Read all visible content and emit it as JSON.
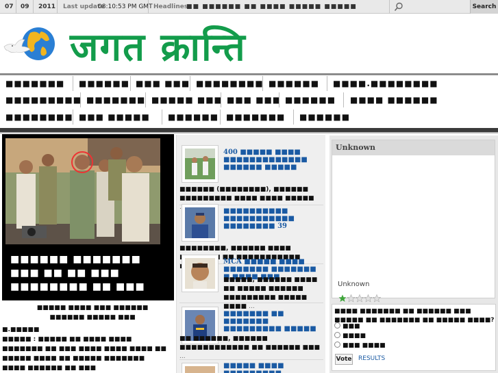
{
  "topbar": {
    "day": "07",
    "month": "09",
    "year": "2011",
    "last_update_label": "Last update",
    "last_update_time": "08:10:53 PM GMT",
    "headlines_label": "Headlines:",
    "headline_ticker": "■■ ■■■■■■ ■■ ■■■■ ■■■■■ ■■■■■",
    "search_placeholder": "",
    "search_button": "Search"
  },
  "site": {
    "title": "जगत क्रान्ति"
  },
  "nav": {
    "row1": [
      "■■■■■■■",
      "■■■■■■",
      "■■■ ■■■",
      "■■■■■■■■",
      "■■■■■■",
      "■■■■.■■■■■■■■"
    ],
    "row2": [
      "■■■■■■■■■",
      "■■■■■■■",
      "■■■■■ ■■■",
      "■■■ ■■■",
      "■■■■■■",
      "■■■■ ■■■■■■"
    ],
    "row3": [
      "■■■■■■■■",
      "■■■ ■■■■■",
      "■■■■■■",
      "■■■■■■■",
      "■■■■■■"
    ]
  },
  "lead": {
    "headline": "■■■■■■ ■■■■■■■ ■■■ ■■ ■■ ■■■ ■■■■■■■■ ■■ ■■■",
    "caption": "■■■■■ ■■■■ ■■■ ■■■■■■ ■■■■■■ ■■■■■ ■■■",
    "body_line1": "■.■■■■■",
    "body_line2": "■■■■■ : ■■■■■ ■■ ■■■■ ■■■■ ■■■■■■■ ■■ ■■■ ■■■■ ■■■■ ■■■■ ■■ ■■■■■ ■■■■ ■■ ■■■■■ ■■■■■■■ ■■■■ ■■■■■■ ■■ ■■■"
  },
  "stories": [
    {
      "title_num": "400",
      "title": "■■■■■ ■■■■ ■■■■■■■■■■■■■ ■■■■■■ ■■■■■",
      "text": "■■■■■■ (■■■■■■■■), ■■■■■■ ■■■■■■■■■ ■■■■ ■■■■ ■■■■■",
      "more": "..."
    },
    {
      "title_num": "39",
      "title": "■■■■■■■■■■ ■■■■■■■■■■■ ■■■■■■■■",
      "text": "■■■■■■■■, ■■■■■■ ■■■■ ■■■■■■■ ■■ ■■■■■■■■■■■ ■■■■■",
      "more": "..."
    },
    {
      "title_num": "MCA",
      "title": "■■■■■ ■■■■ ■■■■■■■ ■■■■■■■ ■ ■■■■ ■■■",
      "text": "■■■■■, ■■■■■■ ■■■■ ■■ ■■■■■ ■■■■■■ ■■■■■■■■■ ■■■■■ ■■■■",
      "more": "..."
    },
    {
      "title_num": "",
      "title": "■■■■■■■ ■■ ■■■■■■■ ■■■■■■■■■ ■■■■■",
      "text": "■■ ■■■■■■, ■■■■■■ ■■■■■■■■■■■■ ■■ ■■■■■■ ■■■",
      "more": "..."
    },
    {
      "title_num": "",
      "title": "■■■■■ ■■■■ ■■■■■■■■■",
      "text": "",
      "more": ""
    }
  ],
  "media": {
    "title": "Unknown",
    "caption": "Unknown",
    "rating": 1,
    "rating_max": 5
  },
  "poll": {
    "question": "■■■■ ■■■■■■■ ■■ ■■■■■■ ■■■ ■■■■■ ■■ ■■■■■■■ ■■ ■■■■■ ■■■■?",
    "options": [
      "■■■",
      "■■■■",
      "■■■ ■■■■"
    ],
    "vote_label": "Vote",
    "results_label": "RESULTS"
  },
  "colors": {
    "brand_green": "#139c4b",
    "link_blue": "#1a5aa3",
    "nav_rule": "#3a3a3a"
  }
}
